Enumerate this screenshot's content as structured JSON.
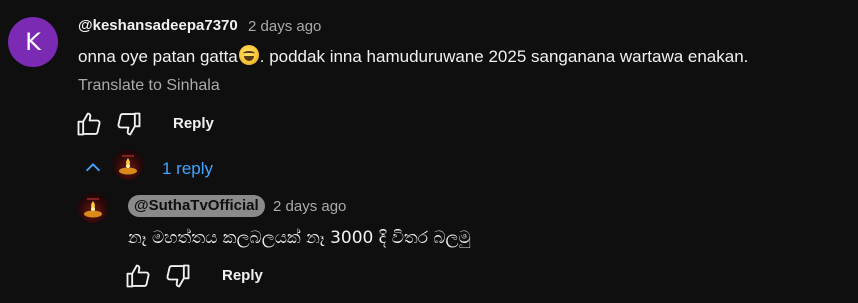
{
  "comment": {
    "avatar_letter": "K",
    "avatar_color": "#7b2bb3",
    "author": "@keshansadeepa7370",
    "timestamp": "2 days ago",
    "text_before_emoji": "onna oye patan gatta",
    "emoji": "face-with-tears-of-joy",
    "text_after_emoji": ". poddak inna hamuduruwane 2025 sanganana wartawa enakan.",
    "translate_label": "Translate to Sinhala",
    "like_icon": "thumbs-up-icon",
    "dislike_icon": "thumbs-down-icon",
    "reply_label": "Reply"
  },
  "replies_toggle": {
    "icon": "chevron-up-icon",
    "count_label": "1 reply",
    "link_color": "#3ea6ff"
  },
  "reply": {
    "author": "@SuthaTvOfficial",
    "timestamp": "2 days ago",
    "text": "නෑ මහත්තය කලබලයක් නෑ 3000 දි විතර බලමු",
    "reply_label": "Reply"
  }
}
